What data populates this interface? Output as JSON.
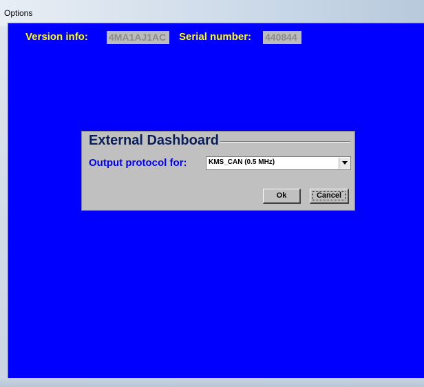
{
  "window": {
    "title": "Options"
  },
  "info": {
    "version_label": "Version info:",
    "version_value": "4MA1AJ1AC",
    "serial_label": "Serial number:",
    "serial_value": "440844"
  },
  "dialog": {
    "group_title": "External Dashboard",
    "protocol_label": "Output protocol for:",
    "protocol_selected": "KMS_CAN (0.5 MHz)",
    "ok_label": "Ok",
    "cancel_label": "Cancel"
  },
  "colors": {
    "background": "#0000ff",
    "label_yellow": "#ffff00",
    "label_blue": "#0000ff",
    "dialog_gray": "#c0c0c0"
  }
}
